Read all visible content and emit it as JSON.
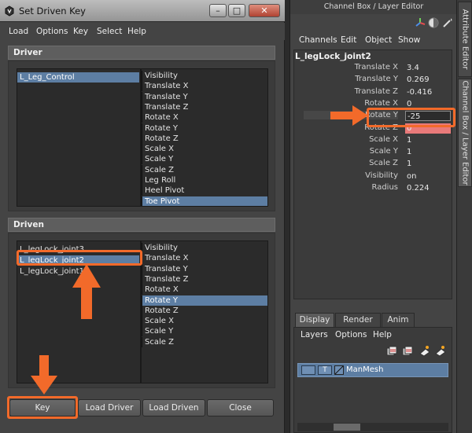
{
  "window": {
    "title": "Set Driven Key",
    "menu": [
      "Load",
      "Options",
      "Key",
      "Select",
      "Help"
    ]
  },
  "driver": {
    "header": "Driver",
    "objects": [
      "L_Leg_Control"
    ],
    "selected_object": "L_Leg_Control",
    "attributes": [
      "Visibility",
      "Translate X",
      "Translate Y",
      "Translate Z",
      "Rotate X",
      "Rotate Y",
      "Rotate Z",
      "Scale X",
      "Scale Y",
      "Scale Z",
      "Leg Roll",
      "Heel Pivot",
      "Toe Pivot"
    ],
    "selected_attribute": "Toe Pivot"
  },
  "driven": {
    "header": "Driven",
    "objects": [
      "L_legLock_joint3",
      "L_legLock_joint2",
      "L_legLock_joint1"
    ],
    "selected_object": "L_legLock_joint2",
    "attributes": [
      "Visibility",
      "Translate X",
      "Translate Y",
      "Translate Z",
      "Rotate X",
      "Rotate Y",
      "Rotate Z",
      "Scale X",
      "Scale Y",
      "Scale Z"
    ],
    "selected_attribute": "Rotate Y"
  },
  "buttons": {
    "key": "Key",
    "load_driver": "Load Driver",
    "load_driven": "Load Driven",
    "close": "Close"
  },
  "channel_box": {
    "title": "Channel Box / Layer Editor",
    "menu": [
      "Channels",
      "Edit",
      "Object",
      "Show"
    ],
    "object_name": "L_legLock_joint2",
    "attributes": [
      {
        "name": "Translate X",
        "value": "3.4"
      },
      {
        "name": "Translate Y",
        "value": "0.269"
      },
      {
        "name": "Translate Z",
        "value": "-0.416"
      },
      {
        "name": "Rotate X",
        "value": "0"
      },
      {
        "name": "Rotate Y",
        "value": "-25"
      },
      {
        "name": "Rotate Z",
        "value": "0"
      },
      {
        "name": "Scale X",
        "value": "1"
      },
      {
        "name": "Scale Y",
        "value": "1"
      },
      {
        "name": "Scale Z",
        "value": "1"
      },
      {
        "name": "Visibility",
        "value": "on"
      },
      {
        "name": "Radius",
        "value": "0.224"
      }
    ],
    "keyed_color": "#e97a7a"
  },
  "layer_editor": {
    "tabs": [
      "Display",
      "Render",
      "Anim"
    ],
    "active_tab": "Display",
    "menu": [
      "Layers",
      "Options",
      "Help"
    ],
    "layer": {
      "visible_toggle": "",
      "type_toggle": "T",
      "name": "ManMesh"
    }
  },
  "side_tabs": [
    "Attribute Editor",
    "Channel Box / Layer Editor"
  ],
  "colors": {
    "selection": "#5d7ea3",
    "annotation": "#f26a2a"
  }
}
